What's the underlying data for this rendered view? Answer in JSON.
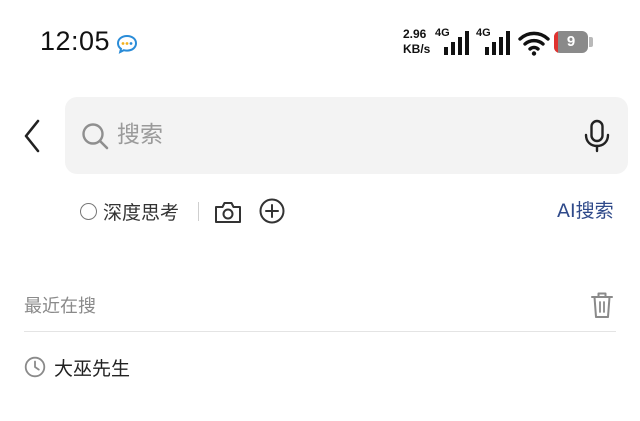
{
  "status_bar": {
    "time": "12:05",
    "speed_value": "2.96",
    "speed_unit": "KB/s",
    "network_1": "4G",
    "network_2": "4G",
    "battery_level": "9",
    "icons": [
      "chat-notification-icon",
      "signal-icon",
      "signal-icon",
      "wifi-icon",
      "battery-icon"
    ]
  },
  "search": {
    "placeholder": "搜索",
    "value": ""
  },
  "tools": {
    "deep_think_label": "深度思考",
    "ai_search_label": "AI搜索"
  },
  "recent": {
    "title": "最近在搜",
    "items": [
      {
        "label": "大巫先生"
      }
    ]
  },
  "colors": {
    "accent": "#2f4a8a",
    "search_bg": "#f3f3f3",
    "battery_low": "#e0322f"
  }
}
